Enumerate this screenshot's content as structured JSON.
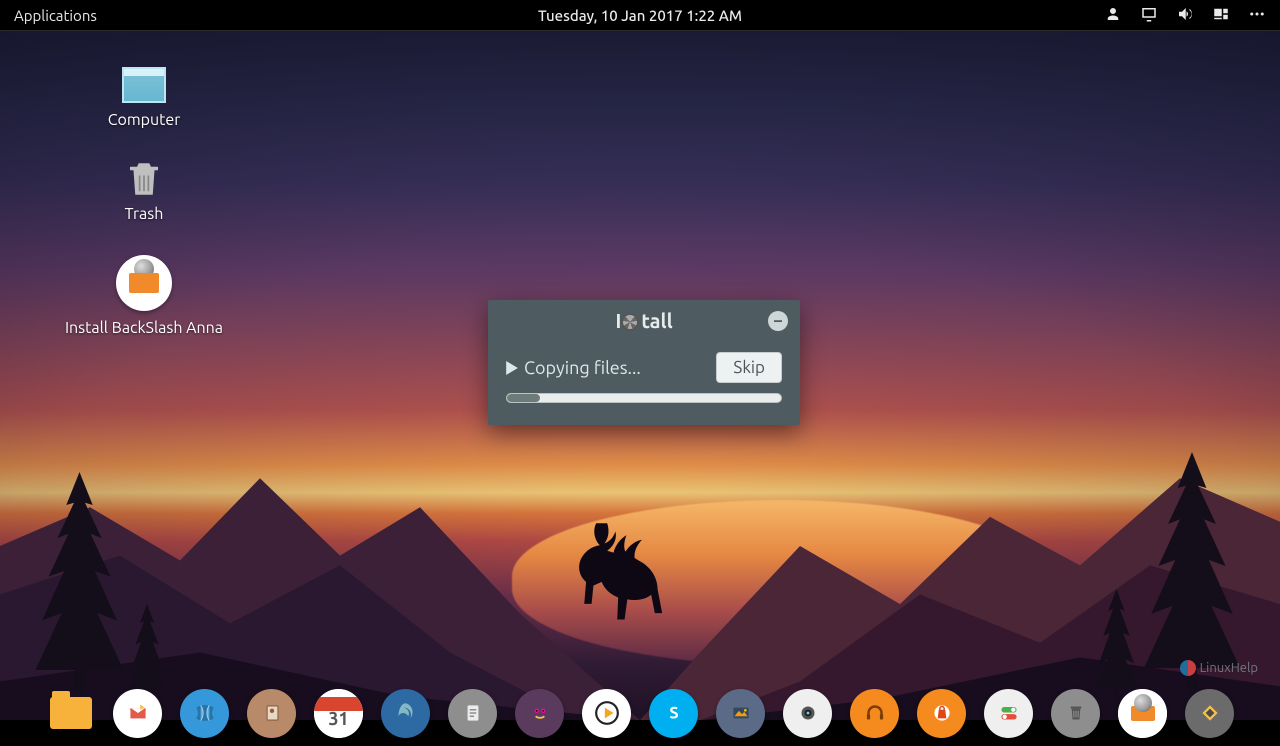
{
  "topbar": {
    "applications_label": "Applications",
    "datetime": "Tuesday, 10 Jan 2017  1:22 AM"
  },
  "desktop_icons": {
    "computer": "Computer",
    "trash": "Trash",
    "install": "Install BackSlash Anna"
  },
  "dialog": {
    "title_prefix": "I",
    "title_suffix": "tall",
    "title_full": "Install",
    "status": "Copying files...",
    "skip_label": "Skip",
    "progress_percent": 12
  },
  "dock": {
    "items": [
      {
        "name": "files",
        "bg": "#f4a016",
        "shape": "folder"
      },
      {
        "name": "mail",
        "bg": "#ffffff",
        "shape": "mail"
      },
      {
        "name": "browser",
        "bg": "#3498db",
        "shape": "globe"
      },
      {
        "name": "contacts",
        "bg": "#b98a6a",
        "shape": "book"
      },
      {
        "name": "calendar",
        "bg": "#ffffff",
        "shape": "calendar",
        "text": "31"
      },
      {
        "name": "google-earth",
        "bg": "#2d6aa3",
        "shape": "swirl"
      },
      {
        "name": "text-editor",
        "bg": "#8e8e8e",
        "shape": "doc"
      },
      {
        "name": "gaming",
        "bg": "#5a3a5d",
        "shape": "eyes"
      },
      {
        "name": "media-player",
        "bg": "#ffffff",
        "shape": "play"
      },
      {
        "name": "skype",
        "bg": "#00aff0",
        "shape": "skype"
      },
      {
        "name": "photos",
        "bg": "#5b6a86",
        "shape": "photo"
      },
      {
        "name": "camera",
        "bg": "#efefef",
        "shape": "cam"
      },
      {
        "name": "headphones",
        "bg": "#f58a1f",
        "shape": "head"
      },
      {
        "name": "software",
        "bg": "#f58a1f",
        "shape": "bag"
      },
      {
        "name": "settings",
        "bg": "#efefef",
        "shape": "toggle"
      },
      {
        "name": "trash",
        "bg": "#8e8e8e",
        "shape": "trash"
      },
      {
        "name": "installer",
        "bg": "#ffffff",
        "shape": "install"
      },
      {
        "name": "updater",
        "bg": "#6b6b6b",
        "shape": "diamond"
      }
    ]
  },
  "watermark": {
    "text": "LinuxHelp"
  }
}
